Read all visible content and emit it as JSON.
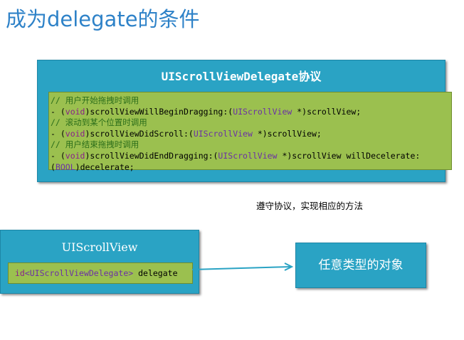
{
  "title": "成为delegate的条件",
  "protocol_box": {
    "title": "UIScrollViewDelegate协议",
    "code": {
      "comment1": "// 用户开始拖拽时调用",
      "line1": {
        "prefix": "- (",
        "kw": "void",
        "mid": ")scrollViewWillBeginDragging:(",
        "type": "UIScrollView",
        "suffix": " *)scrollView;"
      },
      "comment2": "// 滚动到某个位置时调用",
      "line2": {
        "prefix": "- (",
        "kw": "void",
        "mid": ")scrollViewDidScroll:(",
        "type": "UIScrollView",
        "suffix": " *)scrollView;"
      },
      "comment3": "// 用户结束拖拽时调用",
      "line3": {
        "prefix": "- (",
        "kw": "void",
        "mid": ")scrollViewDidEndDragging:(",
        "type": "UIScrollView",
        "suffix": " *)scrollView willDecelerate:"
      },
      "line4": {
        "kw": "BOOL",
        "suffix": ")decelerate;",
        "prefix": "("
      }
    }
  },
  "note": "遵守协议，实现相应的方法",
  "scroll_view_box": {
    "title": "UIScrollView",
    "property": {
      "kw": "id",
      "type": "<UIScrollViewDelegate>",
      "name": " delegate"
    }
  },
  "object_box": {
    "label": "任意类型的对象"
  },
  "colors": {
    "box_blue": "#2aa3c4",
    "code_green": "#9bc04f",
    "title_blue": "#2e82c8",
    "arrow": "#2aa3c4"
  }
}
